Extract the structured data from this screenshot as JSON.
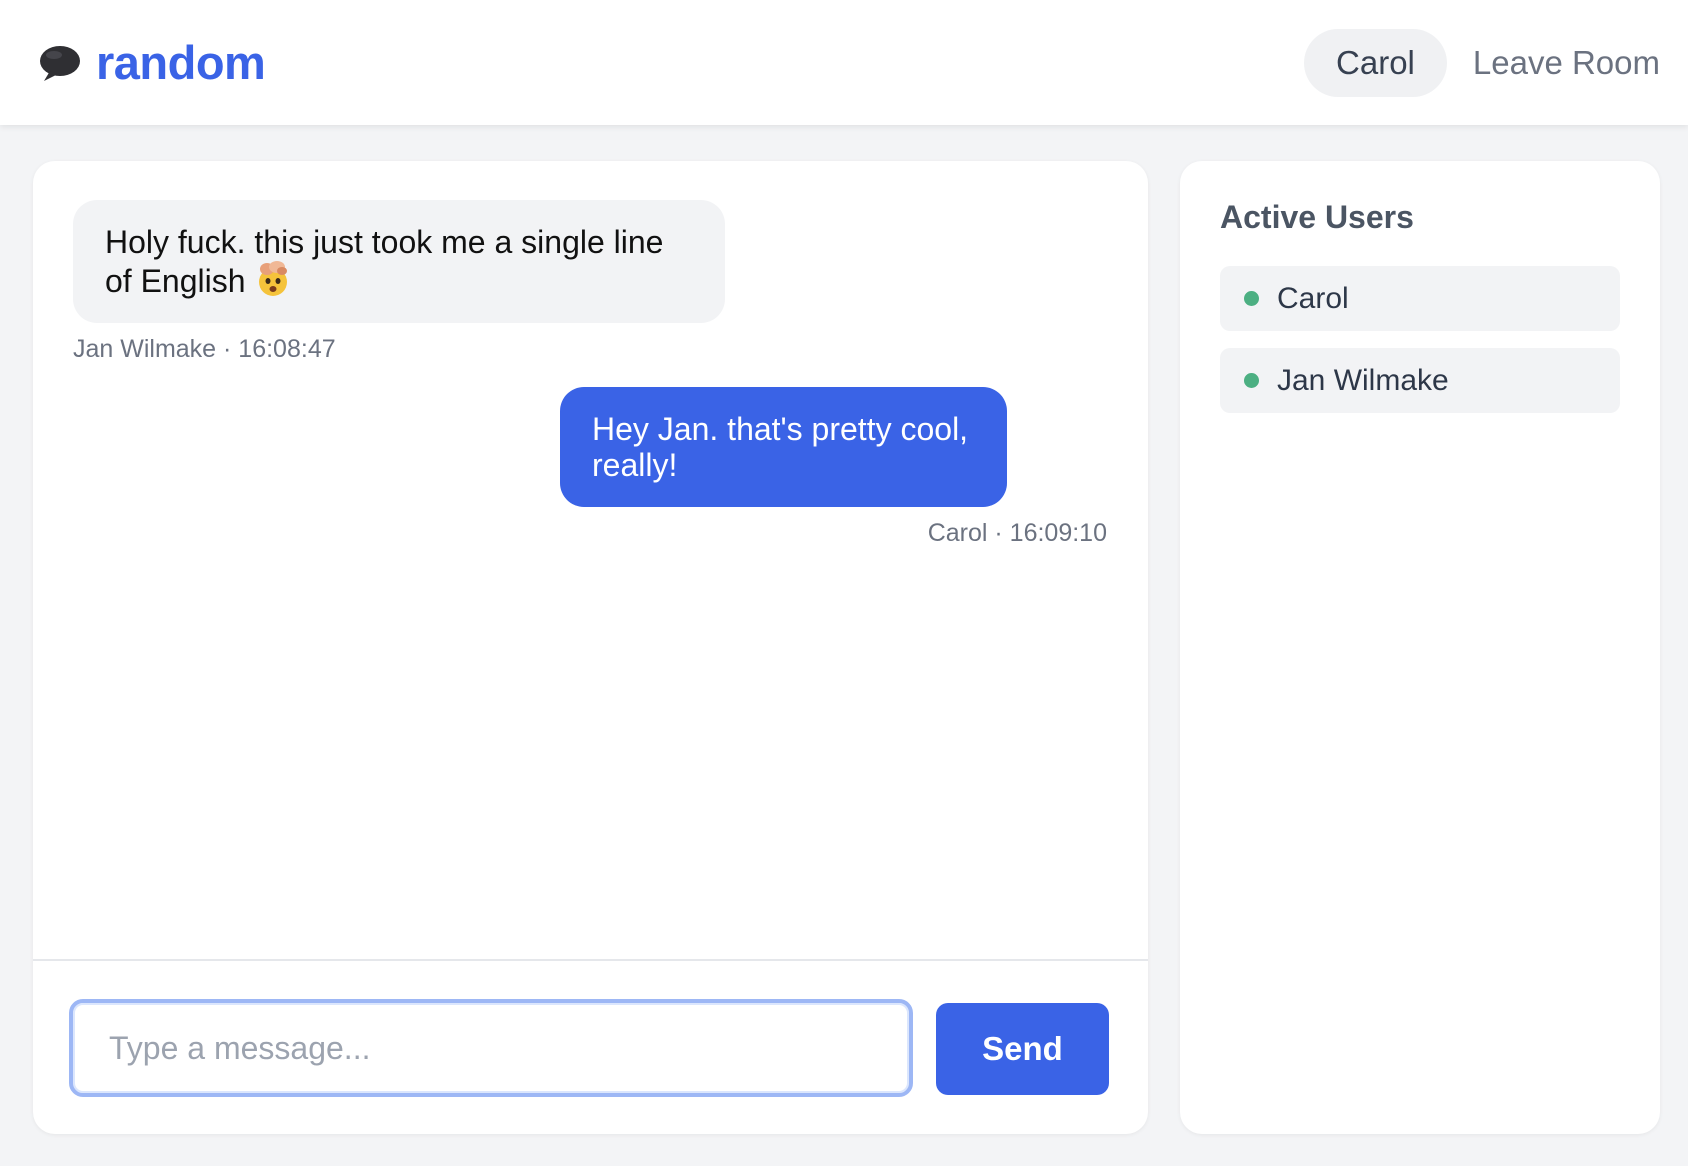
{
  "header": {
    "room_name": "random",
    "current_user": "Carol",
    "leave_label": "Leave Room"
  },
  "messages": [
    {
      "text": "Holy fuck. this just took me a single line of English",
      "emoji": "exploding-head-emoji",
      "meta": "Jan Wilmake · 16:08:47",
      "direction": "incoming"
    },
    {
      "text": "Hey Jan. that's pretty cool, really!",
      "meta": "Carol · 16:09:10",
      "direction": "outgoing"
    }
  ],
  "composer": {
    "placeholder": "Type a message...",
    "value": "",
    "send_label": "Send"
  },
  "users_panel": {
    "title": "Active Users",
    "users": [
      {
        "name": "Carol",
        "status": "online"
      },
      {
        "name": "Jan Wilmake",
        "status": "online"
      }
    ]
  },
  "colors": {
    "accent": "#3a63e6",
    "online": "#4caf82",
    "background": "#f3f4f6"
  },
  "icons": {
    "brand": "speech-bubble-icon"
  }
}
